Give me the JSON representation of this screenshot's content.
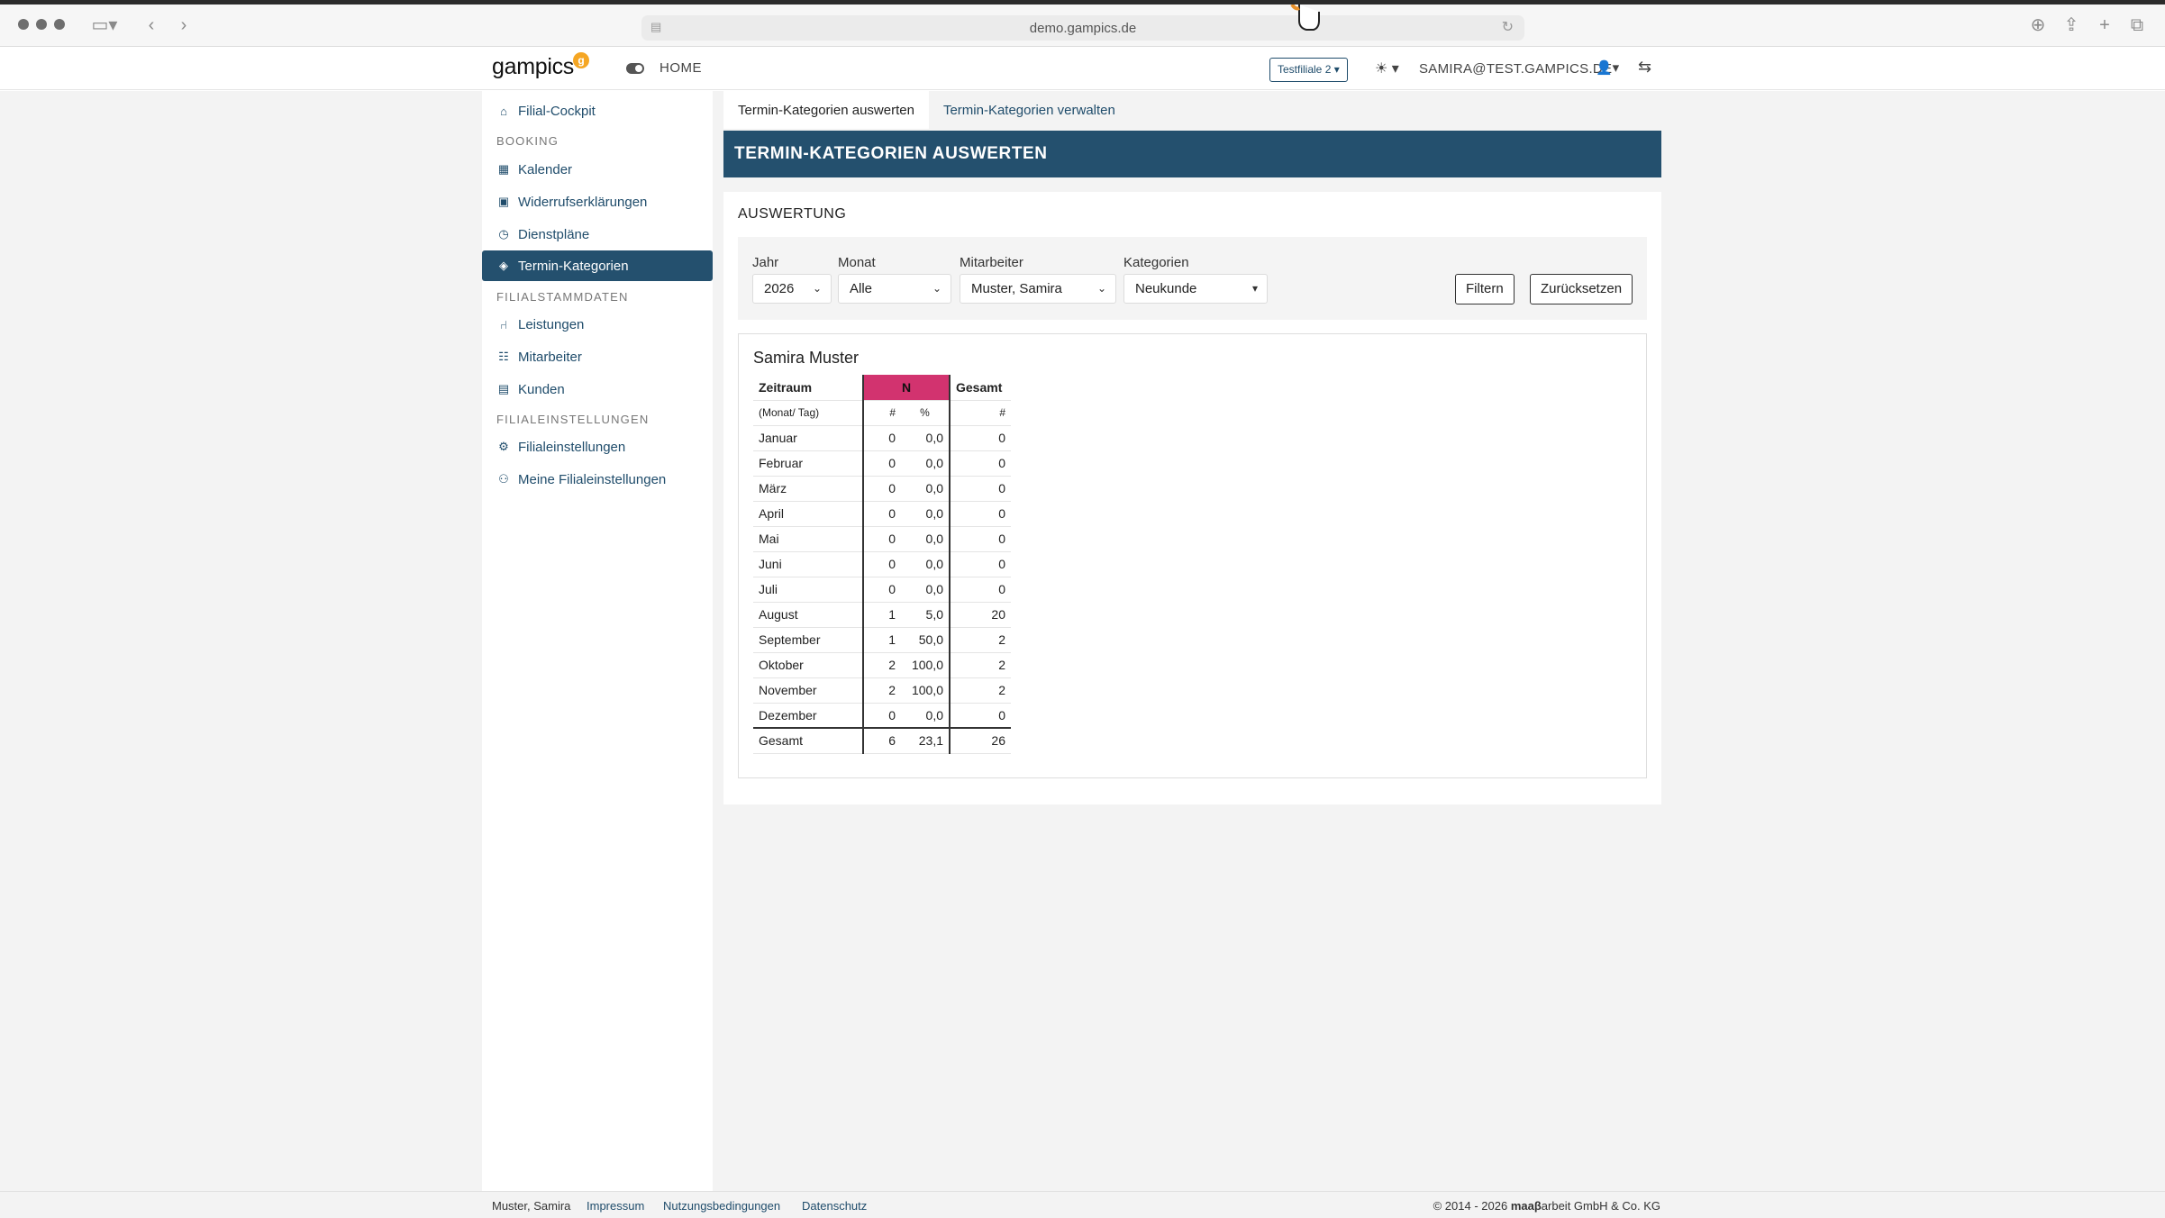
{
  "browser": {
    "url": "demo.gampics.de"
  },
  "navbar": {
    "brand": "gampics",
    "brand_badge": "g",
    "home": "HOME",
    "filiale": "Testfiliale 2",
    "user_email": "SAMIRA@TEST.GAMPICS.DE"
  },
  "sidebar": {
    "items": [
      {
        "label": "Filial-Cockpit",
        "icon": "home-icon"
      },
      {
        "label": "Kalender",
        "icon": "calendar-icon"
      },
      {
        "label": "Widerrufserklärungen",
        "icon": "calendar-x-icon"
      },
      {
        "label": "Dienstpläne",
        "icon": "clock-icon"
      },
      {
        "label": "Termin-Kategorien",
        "icon": "tags-icon",
        "active": true
      },
      {
        "label": "Leistungen",
        "icon": "chair-icon"
      },
      {
        "label": "Mitarbeiter",
        "icon": "users-icon"
      },
      {
        "label": "Kunden",
        "icon": "contact-icon"
      },
      {
        "label": "Filialeinstellungen",
        "icon": "cogs-icon"
      },
      {
        "label": "Meine Filialeinstellungen",
        "icon": "user-cog-icon"
      }
    ],
    "headings": [
      "BOOKING",
      "FILIALSTAMMDATEN",
      "FILIALEINSTELLUNGEN"
    ]
  },
  "tabs": [
    "Termin-Kategorien auswerten",
    "Termin-Kategorien verwalten"
  ],
  "page_title": "TERMIN-KATEGORIEN AUSWERTEN",
  "card_title": "AUSWERTUNG",
  "filters": {
    "jahr_label": "Jahr",
    "jahr_value": "2026",
    "monat_label": "Monat",
    "monat_value": "Alle",
    "mitarbeiter_label": "Mitarbeiter",
    "mitarbeiter_value": "Muster, Samira",
    "kategorien_label": "Kategorien",
    "kategorien_value": "Neukunde",
    "filter_button": "Filtern",
    "reset_button": "Zurücksetzen"
  },
  "result": {
    "name": "Samira Muster",
    "header": {
      "zeitraum": "Zeitraum",
      "n": "N",
      "gesamt": "Gesamt"
    },
    "subheader": {
      "zeitraum": "(Monat/ Tag)",
      "n": "#",
      "p": "%",
      "gesamt": "#"
    },
    "rows": [
      {
        "label": "Januar",
        "n": "0",
        "p": "0,0",
        "g": "0"
      },
      {
        "label": "Februar",
        "n": "0",
        "p": "0,0",
        "g": "0"
      },
      {
        "label": "März",
        "n": "0",
        "p": "0,0",
        "g": "0"
      },
      {
        "label": "April",
        "n": "0",
        "p": "0,0",
        "g": "0"
      },
      {
        "label": "Mai",
        "n": "0",
        "p": "0,0",
        "g": "0"
      },
      {
        "label": "Juni",
        "n": "0",
        "p": "0,0",
        "g": "0"
      },
      {
        "label": "Juli",
        "n": "0",
        "p": "0,0",
        "g": "0"
      },
      {
        "label": "August",
        "n": "1",
        "p": "5,0",
        "g": "20"
      },
      {
        "label": "September",
        "n": "1",
        "p": "50,0",
        "g": "2"
      },
      {
        "label": "Oktober",
        "n": "2",
        "p": "100,0",
        "g": "2"
      },
      {
        "label": "November",
        "n": "2",
        "p": "100,0",
        "g": "2"
      },
      {
        "label": "Dezember",
        "n": "0",
        "p": "0,0",
        "g": "0"
      }
    ],
    "total": {
      "label": "Gesamt",
      "n": "6",
      "p": "23,1",
      "g": "26"
    },
    "accent_color": "#d2336f"
  },
  "footer": {
    "user": "Muster, Samira",
    "links": [
      "Impressum",
      "Nutzungsbedingungen",
      "Datenschutz"
    ],
    "copyright_prefix": "© 2014 - 2026 ",
    "copyright_brand": "maaβ",
    "copyright_suffix": "arbeit GmbH & Co. KG"
  },
  "colors": {
    "primary": "#24506e",
    "accent": "#d2336f",
    "background": "#f3f3f3"
  }
}
